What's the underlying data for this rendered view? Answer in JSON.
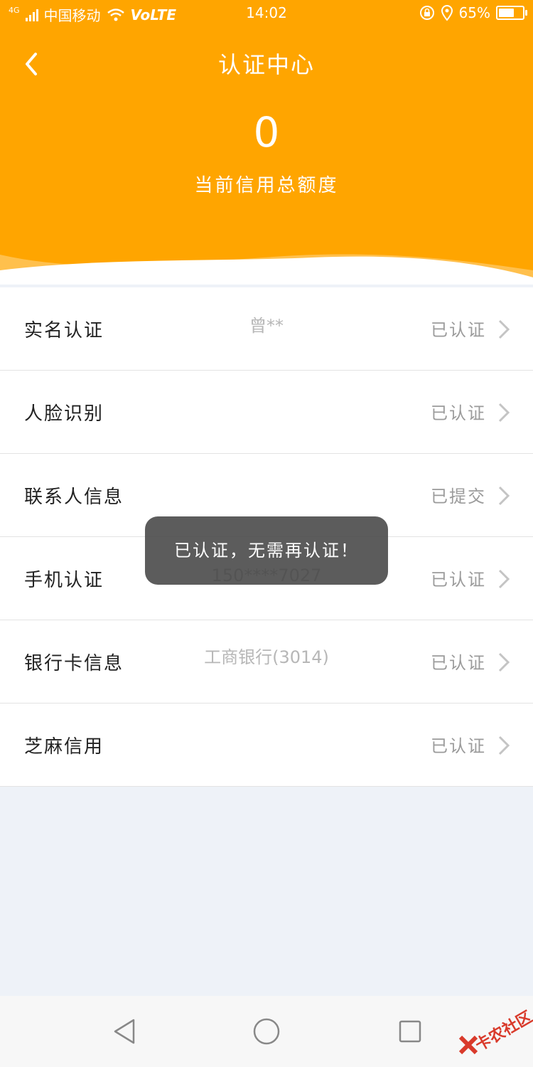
{
  "status_bar": {
    "network_type": "4G",
    "carrier": "中国移动",
    "volte": "VoLTE",
    "time": "14:02",
    "battery_percent": "65%",
    "battery_level": 0.65
  },
  "header": {
    "title": "认证中心",
    "credit_amount": "0",
    "credit_label": "当前信用总额度",
    "background_color": "#ffa500"
  },
  "items": [
    {
      "label": "实名认证",
      "detail": "曾**",
      "status": "已认证"
    },
    {
      "label": "人脸识别",
      "detail": "",
      "status": "已认证"
    },
    {
      "label": "联系人信息",
      "detail": "",
      "status": "已提交"
    },
    {
      "label": "手机认证",
      "detail": "150****7027",
      "status": "已认证"
    },
    {
      "label": "银行卡信息",
      "detail": "工商银行(3014)",
      "status": "已认证"
    },
    {
      "label": "芝麻信用",
      "detail": "",
      "status": "已认证"
    }
  ],
  "toast": {
    "message": "已认证，无需再认证！"
  },
  "nav_bar": {
    "icons": [
      "back-triangle-icon",
      "home-circle-icon",
      "recents-square-icon"
    ]
  },
  "watermark": {
    "text": "卡农社区"
  }
}
